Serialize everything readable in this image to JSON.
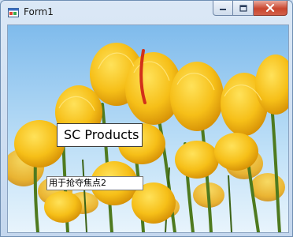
{
  "window": {
    "title": "Form1",
    "icon": "windows-form-icon",
    "caption_buttons": [
      "minimize-icon",
      "maximize-icon",
      "close-icon"
    ]
  },
  "client": {
    "background": "yellow tulips photo against blue sky",
    "product_label": "SC Products",
    "focus_field_text": "用于抢夺焦点2"
  },
  "colors": {
    "tulip": "#f6c21c",
    "tulip_shadow": "#d99406",
    "stem": "#4e7a1f",
    "sky": "#86c0ee",
    "close_button": "#c9462e"
  }
}
